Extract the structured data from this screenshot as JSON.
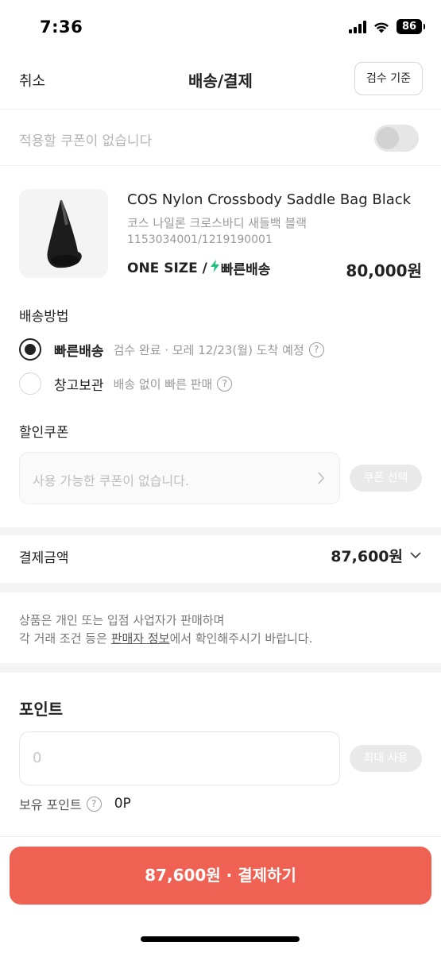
{
  "status_bar": {
    "time": "7:36",
    "battery": "86"
  },
  "header": {
    "cancel_label": "취소",
    "title": "배송/결제",
    "criteria_label": "검수 기준"
  },
  "coupon_toggle": {
    "text": "적용할 쿠폰이 없습니다",
    "on": false
  },
  "product": {
    "name": "COS Nylon Crossbody Saddle Bag Black",
    "korean_name": "코스 나일론 크로스바디 새들백 블랙",
    "code": "1153034001/1219190001",
    "size": "ONE SIZE /",
    "express": "빠른배송",
    "price": "80,000원"
  },
  "delivery": {
    "title": "배송방법",
    "options": [
      {
        "label": "빠른배송",
        "desc": "검수 완료 · 모레 12/23(월) 도착 예정",
        "selected": true
      },
      {
        "label": "창고보관",
        "desc": "배송 없이 빠른 판매",
        "selected": false
      }
    ],
    "help_glyph": "?"
  },
  "discount_coupon": {
    "title": "할인쿠폰",
    "placeholder": "사용 가능한 쿠폰이 없습니다.",
    "select_label": "쿠폰 선택"
  },
  "payment_amount": {
    "label": "결제금액",
    "value": "87,600원"
  },
  "notice": {
    "line1": "상품은 개인 또는 입점 사업자가 판매하며",
    "line2_prefix": "각 거래 조건 등은 ",
    "line2_link": "판매자 정보",
    "line2_suffix": "에서 확인해주시기 바랍니다."
  },
  "points": {
    "title": "포인트",
    "input_value": "0",
    "max_use_label": "최대 사용",
    "owned_label": "보유 포인트",
    "owned_value": "0P"
  },
  "pay_button": {
    "label": "87,600원 · 결제하기"
  },
  "colors": {
    "accent": "#ef6253",
    "express_green": "#1fc27a",
    "disabled_pill": "#e9e9e9"
  }
}
